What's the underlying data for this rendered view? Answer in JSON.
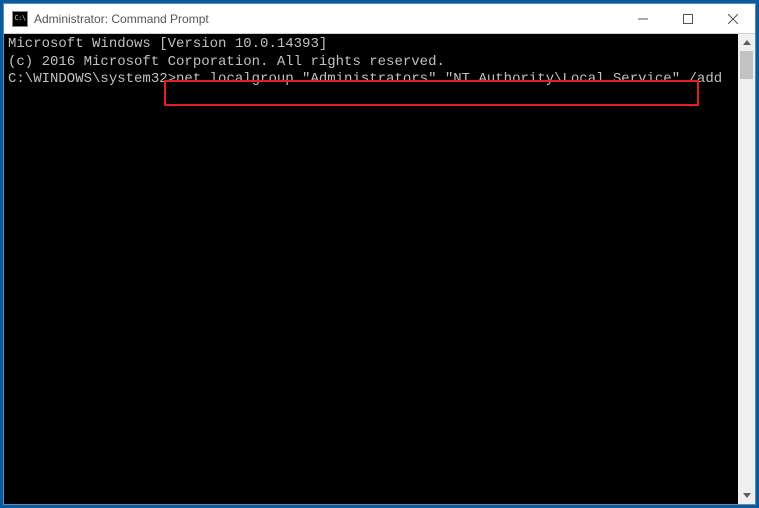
{
  "window": {
    "title": "Administrator: Command Prompt"
  },
  "terminal": {
    "line1": "Microsoft Windows [Version 10.0.14393]",
    "line2": "(c) 2016 Microsoft Corporation. All rights reserved.",
    "blank": "",
    "prompt": "C:\\WINDOWS\\system32>",
    "command": "net localgroup \"Administrators\" \"NT Authority\\Local Service\" /add"
  },
  "icons": {
    "cmd_glyph": "C:\\"
  }
}
